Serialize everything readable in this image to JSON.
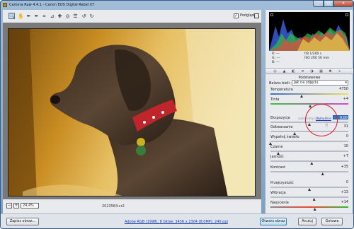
{
  "window": {
    "title": "Camera Raw 4.4.1  -  Canon EOS Digital Rebel XT",
    "controls": [
      "minimize",
      "maximize",
      "close"
    ]
  },
  "toolbar": {
    "tools": [
      {
        "icon": "zoom-icon",
        "glyph": "🔍"
      },
      {
        "icon": "hand-icon",
        "glyph": "✋"
      },
      {
        "icon": "white-balance-icon",
        "glyph": "✒"
      },
      {
        "icon": "color-sampler-icon",
        "glyph": "✒"
      },
      {
        "icon": "crop-icon",
        "glyph": "⌗"
      },
      {
        "icon": "straighten-icon",
        "glyph": "⊿"
      },
      {
        "icon": "spot-removal-icon",
        "glyph": "✚"
      },
      {
        "icon": "red-eye-icon",
        "glyph": "◎"
      },
      {
        "icon": "preferences-icon",
        "glyph": "☰"
      },
      {
        "icon": "rotate-left-icon",
        "glyph": "↺"
      },
      {
        "icon": "rotate-right-icon",
        "glyph": "↻"
      }
    ],
    "preview_checked": true,
    "preview_label": "Podgląd"
  },
  "status": {
    "zoom_value": "24,4%",
    "zoom_out": "−",
    "zoom_in": "+",
    "filename": "2023584.cr2"
  },
  "readout": {
    "r_label": "R:",
    "g_label": "G:",
    "b_label": "B:",
    "r_value": "---",
    "g_value": "---",
    "b_value": "---",
    "exposure_info": "f/8   1/200 s",
    "iso_info": "ISO 200   50 mm"
  },
  "tabs": [
    "◎",
    "▲",
    "◧",
    "≡",
    "◑",
    "▦",
    "✺",
    "⌖"
  ],
  "panel": {
    "title": "Podstawowe",
    "white_balance_label": "Balans bieli:",
    "white_balance_value": "Jak na zdjęciu",
    "auto_link": "automatyczny",
    "default_link": "domyślne",
    "sliders": [
      {
        "label": "Temperatura",
        "value": "4750",
        "pos": 0.4,
        "gradient": "temp"
      },
      {
        "label": "Tinta",
        "value": "+4",
        "pos": 0.51,
        "gradient": "tint"
      },
      {
        "label": "Ekspozycja",
        "value": "0,00",
        "pos": 0.5,
        "selected": true
      },
      {
        "label": "Odtwarzanie",
        "value": "31",
        "pos": 0.31
      },
      {
        "label": "Wypełnij światło",
        "value": "0",
        "pos": 0.0
      },
      {
        "label": "Czarne",
        "value": "10",
        "pos": 0.1
      },
      {
        "label": "Jasność",
        "value": "+7",
        "pos": 0.53
      },
      {
        "label": "Kontrast",
        "value": "+35",
        "pos": 0.67
      },
      {
        "label": "Przejrzystość",
        "value": "0",
        "pos": 0.5
      },
      {
        "label": "Wibracja",
        "value": "+13",
        "pos": 0.56
      },
      {
        "label": "Nasycenie",
        "value": "+14",
        "pos": 0.57,
        "gradient": "sat"
      }
    ]
  },
  "bottom": {
    "save_label": "Zapisz obraz...",
    "info_link": "Adobe RGB (1998); 8 bitów; 3456 x 2304 (8,0MP); 240 ppi",
    "open_label": "Otwórz obraz",
    "cancel_label": "Anuluj",
    "done_label": "Gotowe"
  },
  "colors": {
    "accent": "#3973c6",
    "highlight_circle": "#d8232a",
    "link": "#1a3fb0"
  }
}
